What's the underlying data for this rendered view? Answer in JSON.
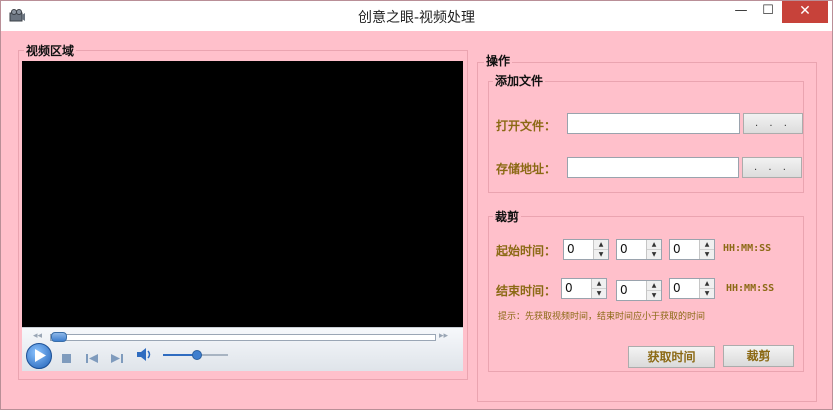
{
  "window": {
    "title": "创意之眼-视频处理",
    "controls": {
      "minimize": "—",
      "maximize": "☐",
      "close": "✕"
    }
  },
  "video_area": {
    "label": "视频区域",
    "seek_progress": 0.0,
    "volume_level": 0.5
  },
  "operations": {
    "label": "操作",
    "add_file": {
      "label": "添加文件",
      "open_file_label": "打开文件：",
      "open_file_value": "",
      "save_path_label": "存储地址：",
      "save_path_value": "",
      "browse_label": ". . ."
    },
    "crop": {
      "label": "裁剪",
      "start_label": "起始时间：",
      "end_label": "结束时间：",
      "start": {
        "h": "0",
        "m": "0",
        "s": "0"
      },
      "end": {
        "h": "0",
        "m": "0",
        "s": "0"
      },
      "format": "HH:MM:SS",
      "hint": "提示：先获取视频时间，结束时间应小于获取的时间",
      "get_time_button": "获取时间",
      "crop_button": "裁剪"
    }
  },
  "colors": {
    "background": "#ffc0cb",
    "label_text": "#8b6914",
    "close_button": "#c7423a"
  }
}
